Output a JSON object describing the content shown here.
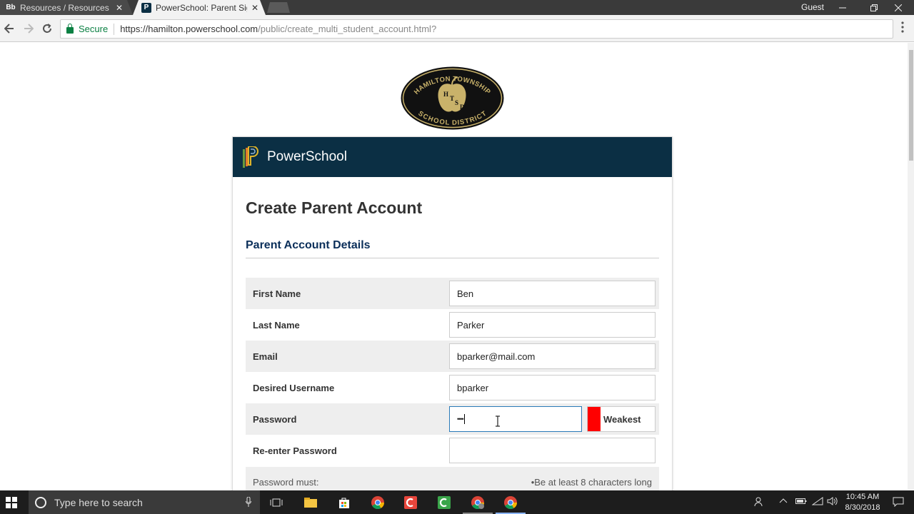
{
  "browser": {
    "tabs": [
      {
        "favicon": "Bb",
        "title": "Resources / Resources H"
      },
      {
        "favicon": "P",
        "title": "PowerSchool: Parent Sign"
      }
    ],
    "close_glyph": "✕",
    "user": "Guest",
    "secure_label": "Secure",
    "url_host": "https://hamilton.powerschool.com",
    "url_path": "/public/create_multi_student_account.html?"
  },
  "logo": {
    "top_text": "HAMILTON TOWNSHIP",
    "bottom_text": "SCHOOL DISTRICT",
    "center_text": "HTSD"
  },
  "header": {
    "brand": "PowerSchool"
  },
  "page": {
    "title": "Create Parent Account",
    "section": "Parent Account Details"
  },
  "form": {
    "first_name_label": "First Name",
    "first_name_value": "Ben",
    "last_name_label": "Last Name",
    "last_name_value": "Parker",
    "email_label": "Email",
    "email_value": "bparker@mail.com",
    "username_label": "Desired Username",
    "username_value": "bparker",
    "password_label": "Password",
    "password_value": "••••",
    "strength_label": "Weakest",
    "reenter_label": "Re-enter Password",
    "reenter_value": "",
    "password_must_label": "Password must:",
    "password_rule": "•Be at least 8 characters long"
  },
  "colors": {
    "header_bg": "#0b2f44",
    "section_title": "#0b2f5a",
    "strength_weak": "#ff0000",
    "secure_green": "#0b8043"
  },
  "taskbar": {
    "search_placeholder": "Type here to search",
    "time": "10:45 AM",
    "date": "8/30/2018"
  }
}
